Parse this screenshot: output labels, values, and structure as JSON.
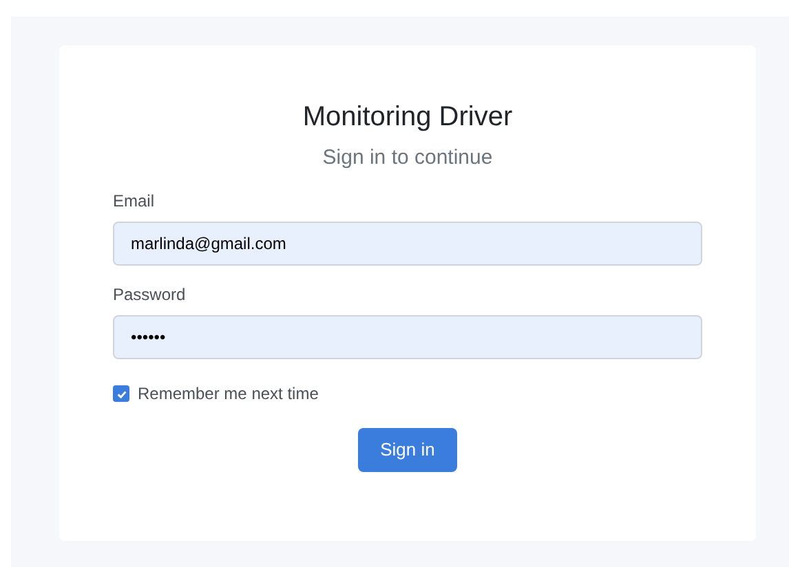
{
  "title": "Monitoring Driver",
  "subtitle": "Sign in to continue",
  "fields": [
    {
      "label": "Email",
      "value": "marlinda@gmail.com"
    },
    {
      "label": "Password",
      "value": "••••••"
    }
  ],
  "remember": {
    "label": "Remember me next time",
    "checked": true
  },
  "button": "Sign in"
}
